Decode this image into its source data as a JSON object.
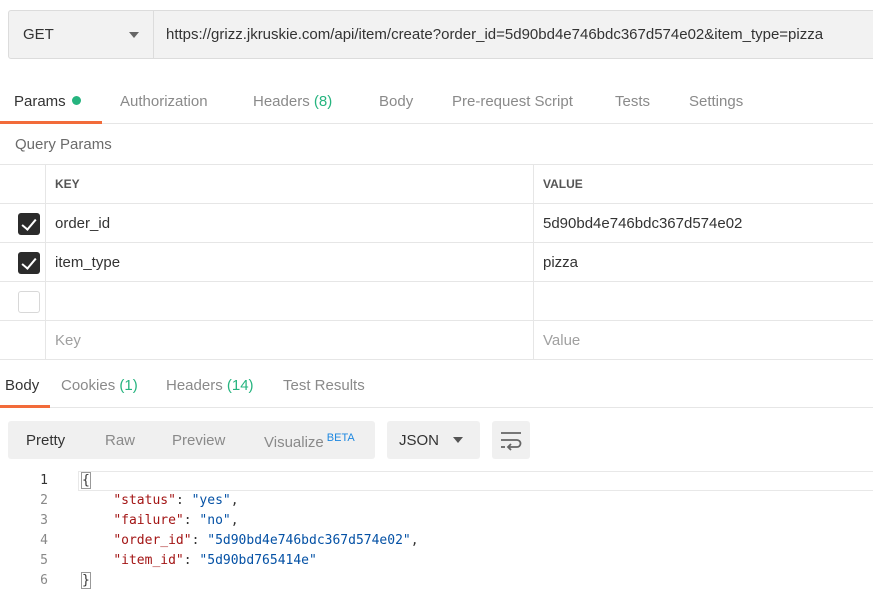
{
  "request": {
    "method": "GET",
    "url": "https://grizz.jkruskie.com/api/item/create?order_id=5d90bd4e746bdc367d574e02&item_type=pizza"
  },
  "request_tabs": [
    {
      "label": "Params",
      "active": true,
      "dot": true
    },
    {
      "label": "Authorization"
    },
    {
      "label": "Headers",
      "count": "(8)"
    },
    {
      "label": "Body"
    },
    {
      "label": "Pre-request Script"
    },
    {
      "label": "Tests"
    },
    {
      "label": "Settings"
    }
  ],
  "query_params": {
    "title": "Query Params",
    "headers": {
      "key": "KEY",
      "value": "VALUE"
    },
    "rows": [
      {
        "checked": true,
        "key": "order_id",
        "value": "5d90bd4e746bdc367d574e02"
      },
      {
        "checked": true,
        "key": "item_type",
        "value": "pizza"
      },
      {
        "checked": false,
        "key": "",
        "value": ""
      }
    ],
    "placeholder": {
      "key": "Key",
      "value": "Value"
    }
  },
  "response_tabs": [
    {
      "label": "Body",
      "active": true
    },
    {
      "label": "Cookies",
      "count": "(1)"
    },
    {
      "label": "Headers",
      "count": "(14)"
    },
    {
      "label": "Test Results"
    }
  ],
  "view_modes": {
    "pretty": "Pretty",
    "raw": "Raw",
    "preview": "Preview",
    "visualize": "Visualize",
    "beta": "BETA"
  },
  "format": "JSON",
  "code": {
    "line_numbers": [
      "1",
      "2",
      "3",
      "4",
      "5",
      "6"
    ],
    "open_brace": "{",
    "close_brace": "}",
    "entries": [
      {
        "key": "\"status\"",
        "value": "\"yes\"",
        "sep": ","
      },
      {
        "key": "\"failure\"",
        "value": "\"no\"",
        "sep": ","
      },
      {
        "key": "\"order_id\"",
        "value": "\"5d90bd4e746bdc367d574e02\"",
        "sep": ","
      },
      {
        "key": "\"item_id\"",
        "value": "\"5d90bd765414e\"",
        "sep": ""
      }
    ]
  },
  "colors": {
    "accent": "#f26b3a",
    "count_green": "#26b47f",
    "beta_blue": "#1f88e0"
  },
  "icons": [
    "chevron-down-icon",
    "checkbox-checked-icon",
    "wrap-lines-icon"
  ]
}
